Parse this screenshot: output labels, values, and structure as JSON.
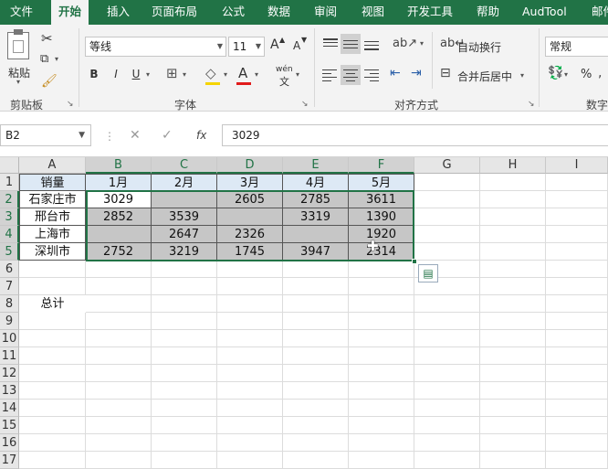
{
  "tabs": [
    "文件",
    "开始",
    "插入",
    "页面布局",
    "公式",
    "数据",
    "审阅",
    "视图",
    "开发工具",
    "帮助",
    "AudTool",
    "邮件"
  ],
  "clipboard": {
    "paste_label": "粘贴",
    "group_label": "剪贴板"
  },
  "font": {
    "name": "等线",
    "size": "11",
    "bold": "B",
    "italic": "I",
    "underline": "U",
    "grow": "A",
    "shrink": "A",
    "font_color": "A",
    "phonetic": "wén",
    "group_label": "字体"
  },
  "alignment": {
    "wrap_label": "自动换行",
    "merge_label": "合并后居中",
    "group_label": "对齐方式"
  },
  "number": {
    "format": "常规",
    "percent": "%",
    "group_label": "数字"
  },
  "formula_bar": {
    "name_box": "B2",
    "value": "3029",
    "fx": "fx"
  },
  "columns": [
    "A",
    "B",
    "C",
    "D",
    "E",
    "F",
    "G",
    "H",
    "I"
  ],
  "rows": [
    "1",
    "2",
    "3",
    "4",
    "5",
    "6",
    "7",
    "8",
    "9",
    "10",
    "11",
    "12",
    "13",
    "14",
    "15",
    "16",
    "17"
  ],
  "table": {
    "header": [
      "销量",
      "1月",
      "2月",
      "3月",
      "4月",
      "5月"
    ],
    "data": [
      [
        "石家庄市",
        "3029",
        "",
        "2605",
        "2785",
        "3611"
      ],
      [
        "邢台市",
        "2852",
        "3539",
        "",
        "3319",
        "1390"
      ],
      [
        "上海市",
        "",
        "2647",
        "2326",
        "",
        "1920"
      ],
      [
        "深圳市",
        "2752",
        "3219",
        "1745",
        "3947",
        "2314"
      ]
    ],
    "total_label": "总计"
  },
  "colors": {
    "accent": "#217346",
    "selection_gray": "#c6c6c6",
    "header_fill": "#dde9f5"
  }
}
